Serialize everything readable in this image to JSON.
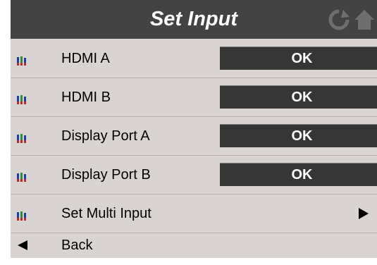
{
  "header": {
    "title": "Set Input",
    "icons": [
      "refresh-icon",
      "home-icon"
    ]
  },
  "items": [
    {
      "label": "HDMI A",
      "status": "OK",
      "icon": "input-connector-icon"
    },
    {
      "label": "HDMI B",
      "status": "OK",
      "icon": "input-connector-icon"
    },
    {
      "label": "Display Port A",
      "status": "OK",
      "icon": "input-connector-icon"
    },
    {
      "label": "Display Port B",
      "status": "OK",
      "icon": "input-connector-icon"
    },
    {
      "label": "Set Multi Input",
      "icon": "input-connector-icon",
      "indicator": "chevron-right-icon"
    }
  ],
  "back": {
    "label": "Back",
    "icon": "back-arrow-icon"
  },
  "colors": {
    "header_bg": "#434343",
    "screen_bg": "#d9d4d2",
    "button_bg": "#363636"
  }
}
